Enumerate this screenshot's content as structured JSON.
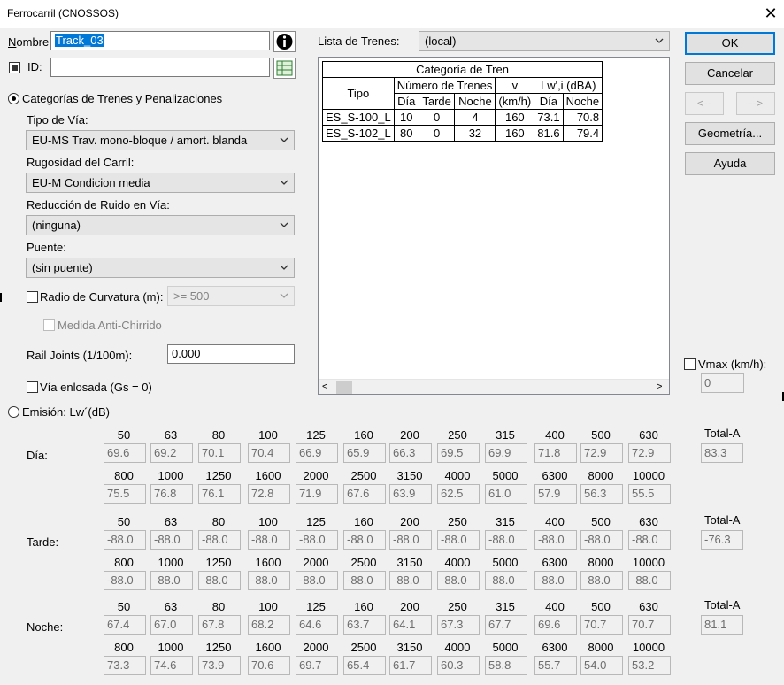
{
  "window": {
    "title": "Ferrocarril (CNOSSOS)"
  },
  "form": {
    "nombre_label": "Nombre",
    "nombre_value": "Track_03",
    "id_label": "ID:",
    "id_value": "",
    "lista_label": "Lista de Trenes:",
    "lista_value": "(local)",
    "categorias_label": "Categorías de Trenes y Penalizaciones",
    "tipo_via_label": "Tipo de Vía:",
    "tipo_via_value": "EU-MS Trav. mono-bloque / amort. blanda",
    "rugosidad_label": "Rugosidad del Carril:",
    "rugosidad_value": "EU-M Condicion media",
    "reduccion_label": "Reducción de Ruido en Vía:",
    "reduccion_value": "(ninguna)",
    "puente_label": "Puente:",
    "puente_value": "(sin puente)",
    "radio_curvatura_label": "Radio de Curvatura (m):",
    "radio_curvatura_value": ">= 500",
    "anti_chirrido_label": "Medida Anti-Chirrido",
    "rail_joints_label": "Rail Joints (1/100m):",
    "rail_joints_value": "0.000",
    "via_enlosada_label": "Vía enlosada (Gs = 0)",
    "vmax_label": "Vmax (km/h):",
    "vmax_value": "0",
    "emision_label": "Emisión: Lw´(dB)"
  },
  "buttons": {
    "ok": "OK",
    "cancel": "Cancelar",
    "prev": "<--",
    "next": "-->",
    "geometry": "Geometría...",
    "help": "Ayuda"
  },
  "train_table": {
    "header_title": "Categoría de Tren",
    "col_tipo": "Tipo",
    "col_numero": "Número de Trenes",
    "col_v": "v",
    "col_lw": "Lw',i (dBA)",
    "sub_dia": "Día",
    "sub_tarde": "Tarde",
    "sub_noche": "Noche",
    "sub_kmh": "(km/h)",
    "sub_lw_dia": "Día",
    "sub_lw_noche": "Noche",
    "rows": [
      {
        "tipo": "ES_S-100_L",
        "dia": "10",
        "tarde": "0",
        "noche": "4",
        "v": "160",
        "lw_dia": "73.1",
        "lw_noche": "70.8"
      },
      {
        "tipo": "ES_S-102_L",
        "dia": "80",
        "tarde": "0",
        "noche": "32",
        "v": "160",
        "lw_dia": "81.6",
        "lw_noche": "79.4"
      }
    ]
  },
  "emission": {
    "freq_row1": [
      "50",
      "63",
      "80",
      "100",
      "125",
      "160",
      "200",
      "250",
      "315",
      "400",
      "500",
      "630"
    ],
    "freq_row2": [
      "800",
      "1000",
      "1250",
      "1600",
      "2000",
      "2500",
      "3150",
      "4000",
      "5000",
      "6300",
      "8000",
      "10000"
    ],
    "total_label": "Total-A",
    "periods": [
      {
        "label": "Día:",
        "row1": [
          "69.6",
          "69.2",
          "70.1",
          "70.4",
          "66.9",
          "65.9",
          "66.3",
          "69.5",
          "69.9",
          "71.8",
          "72.9",
          "72.9"
        ],
        "row2": [
          "75.5",
          "76.8",
          "76.1",
          "72.8",
          "71.9",
          "67.6",
          "63.9",
          "62.5",
          "61.0",
          "57.9",
          "56.3",
          "55.5"
        ],
        "total": "83.3"
      },
      {
        "label": "Tarde:",
        "row1": [
          "-88.0",
          "-88.0",
          "-88.0",
          "-88.0",
          "-88.0",
          "-88.0",
          "-88.0",
          "-88.0",
          "-88.0",
          "-88.0",
          "-88.0",
          "-88.0"
        ],
        "row2": [
          "-88.0",
          "-88.0",
          "-88.0",
          "-88.0",
          "-88.0",
          "-88.0",
          "-88.0",
          "-88.0",
          "-88.0",
          "-88.0",
          "-88.0",
          "-88.0"
        ],
        "total": "-76.3"
      },
      {
        "label": "Noche:",
        "row1": [
          "67.4",
          "67.0",
          "67.8",
          "68.2",
          "64.6",
          "63.7",
          "64.1",
          "67.3",
          "67.7",
          "69.6",
          "70.7",
          "70.7"
        ],
        "row2": [
          "73.3",
          "74.6",
          "73.9",
          "70.6",
          "69.7",
          "65.4",
          "61.7",
          "60.3",
          "58.8",
          "55.7",
          "54.0",
          "53.2"
        ],
        "total": "81.1"
      }
    ]
  }
}
